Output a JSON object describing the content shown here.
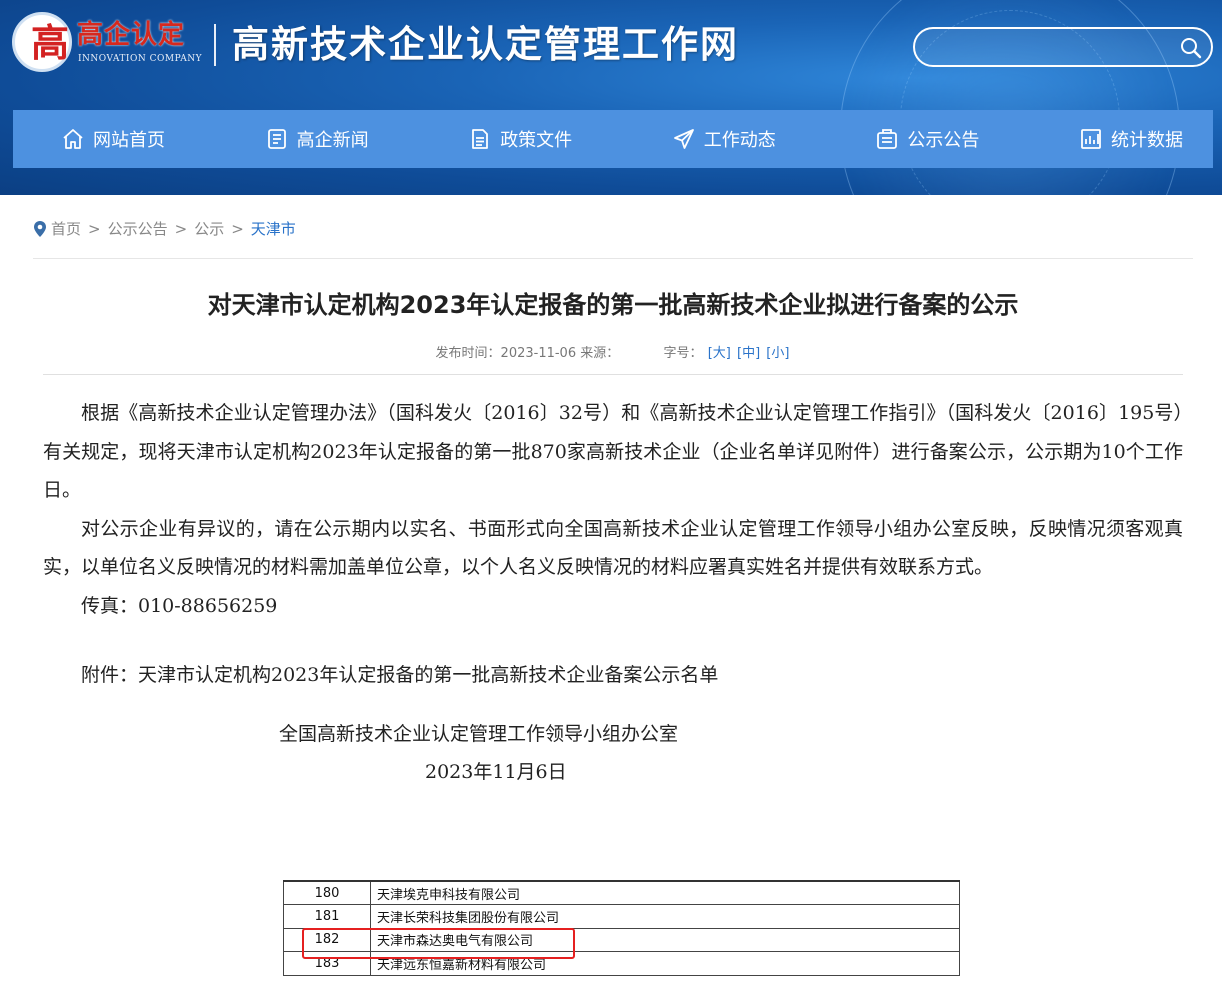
{
  "header": {
    "logo_mark": "高",
    "logo_text": "高企认定",
    "logo_sub": "INNOVATION COMPANY",
    "site_title": "高新技术企业认定管理工作网",
    "search_placeholder": ""
  },
  "nav": {
    "items": [
      {
        "label": "网站首页",
        "icon": "home-icon"
      },
      {
        "label": "高企新闻",
        "icon": "news-icon"
      },
      {
        "label": "政策文件",
        "icon": "document-icon"
      },
      {
        "label": "工作动态",
        "icon": "send-icon"
      },
      {
        "label": "公示公告",
        "icon": "announcement-icon"
      },
      {
        "label": "统计数据",
        "icon": "chart-icon"
      }
    ]
  },
  "breadcrumb": {
    "items": [
      "首页",
      "公示公告",
      "公示"
    ],
    "current": "天津市",
    "separator": ">"
  },
  "article": {
    "title": "对天津市认定机构2023年认定报备的第一批高新技术企业拟进行备案的公示",
    "meta_date_label": "发布时间：2023-11-06",
    "meta_source_label": "来源：",
    "meta_fontsize_label": "字号：",
    "size_large": "[大]",
    "size_medium": "[中]",
    "size_small": "[小]",
    "p1": "根据《高新技术企业认定管理办法》（国科发火〔2016〕32号）和《高新技术企业认定管理工作指引》（国科发火〔2016〕195号）有关规定，现将天津市认定机构2023年认定报备的第一批870家高新技术企业（企业名单详见附件）进行备案公示，公示期为10个工作日。",
    "p2": "对公示企业有异议的，请在公示期内以实名、书面形式向全国高新技术企业认定管理工作领导小组办公室反映，反映情况须客观真实，以单位名义反映情况的材料需加盖单位公章，以个人名义反映情况的材料应署真实姓名并提供有效联系方式。",
    "fax": "传真：010-88656259",
    "attachment": "附件：天津市认定机构2023年认定报备的第一批高新技术企业备案公示名单",
    "sign_org": "全国高新技术企业认定管理工作领导小组办公室",
    "sign_date": "2023年11月6日"
  },
  "table": {
    "rows": [
      {
        "no": "180",
        "name": "天津埃克申科技有限公司"
      },
      {
        "no": "181",
        "name": "天津长荣科技集团股份有限公司"
      },
      {
        "no": "182",
        "name": "天津市森达奥电气有限公司"
      },
      {
        "no": "183",
        "name": "天津远东恒嘉新材料有限公司"
      }
    ],
    "highlighted_row": "182"
  },
  "colors": {
    "header_bg": "#1a64b6",
    "nav_bg": "#4d91e0",
    "logo_red": "#d6281e",
    "link_blue": "#2a73c9",
    "highlight_red": "#e52020"
  }
}
